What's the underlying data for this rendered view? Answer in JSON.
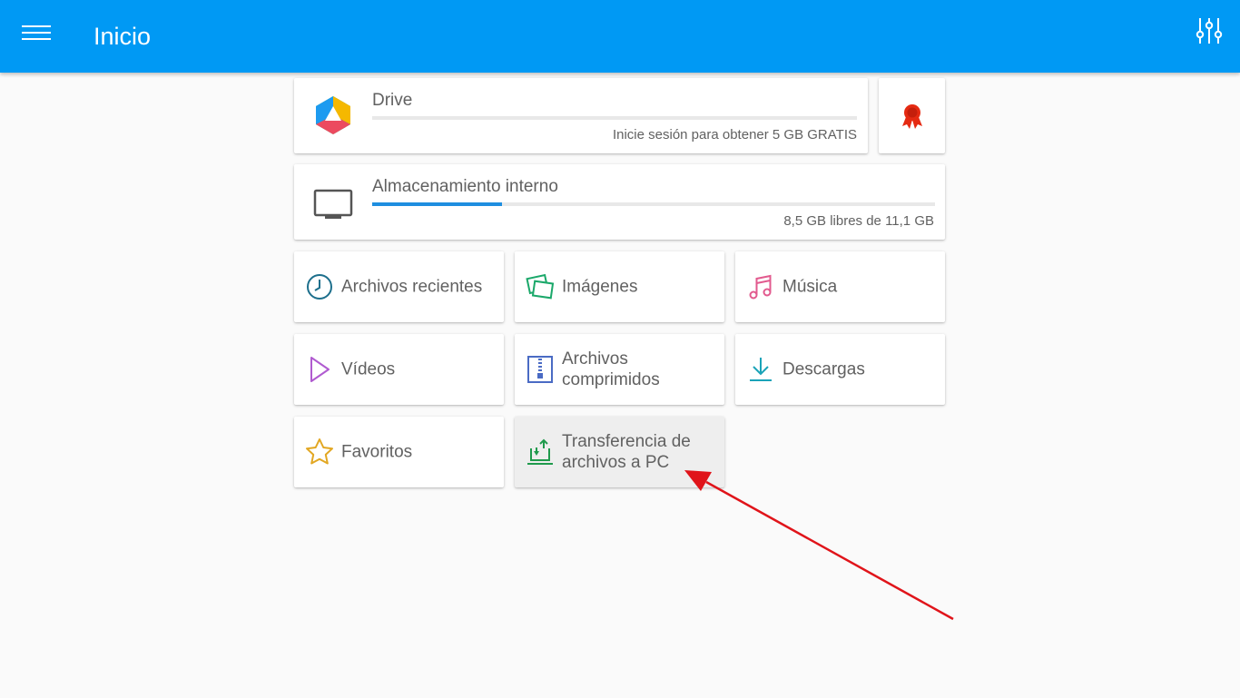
{
  "appbar": {
    "title": "Inicio",
    "menu_icon": "hamburger-menu-icon",
    "settings_icon": "sliders-icon",
    "color": "#0099f4"
  },
  "drive": {
    "name": "Drive",
    "subtitle": "Inicie sesión para obtener 5 GB GRATIS",
    "icon": "drive-hexagon-logo",
    "usage_fraction": 0
  },
  "premium": {
    "icon": "award-ribbon-icon",
    "color": "#e52a12"
  },
  "internal": {
    "name": "Almacenamiento interno",
    "subtitle": "8,5 GB libres de 11,1 GB",
    "icon": "monitor-icon",
    "usage_fraction": 0.23
  },
  "tiles": {
    "recent": {
      "label": "Archivos recientes",
      "icon": "clock-icon",
      "color": "#1d6f8c"
    },
    "images": {
      "label": "Imágenes",
      "icon": "images-icon",
      "color": "#1ba86a"
    },
    "music": {
      "label": "Música",
      "icon": "music-note-icon",
      "color": "#e25a8e"
    },
    "videos": {
      "label": "Vídeos",
      "icon": "play-icon",
      "color": "#b05bd0"
    },
    "archives": {
      "label": "Archivos comprimidos",
      "icon": "zip-icon",
      "color": "#4a6bc4"
    },
    "downloads": {
      "label": "Descargas",
      "icon": "download-icon",
      "color": "#1aa3b8"
    },
    "favorites": {
      "label": "Favoritos",
      "icon": "star-icon",
      "color": "#e2a722"
    },
    "pc_transfer": {
      "label": "Transferencia de archivos a PC",
      "icon": "laptop-transfer-icon",
      "color": "#1f9a4c"
    }
  },
  "annotation": {
    "color": "#e0141a"
  }
}
